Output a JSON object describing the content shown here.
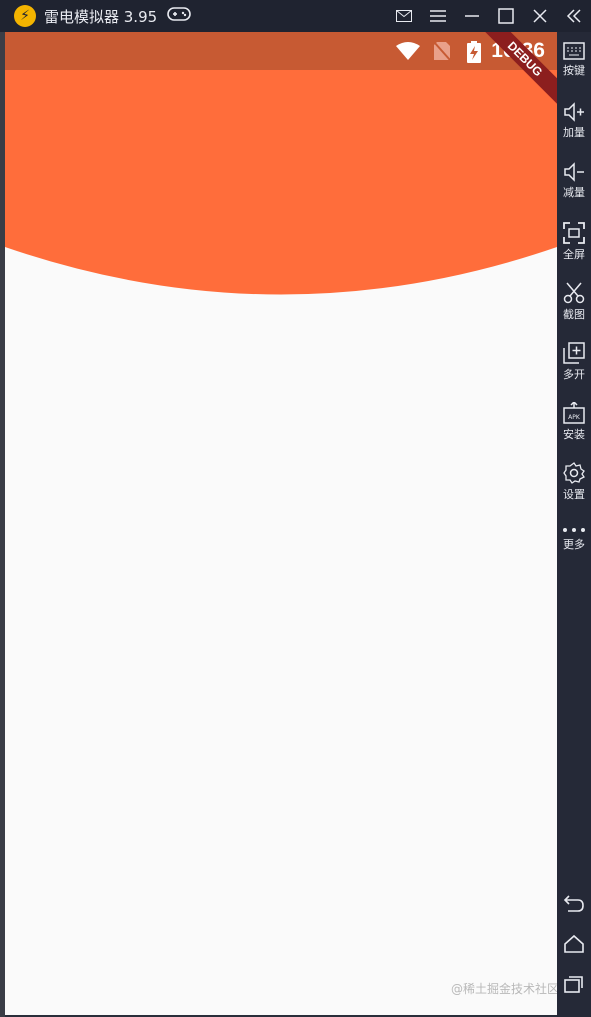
{
  "window": {
    "title": "雷电模拟器 3.95",
    "logo_icon": "leidian-logo",
    "controls": [
      "mail-icon",
      "menu-icon",
      "minimize-icon",
      "maximize-icon",
      "close-icon"
    ]
  },
  "status_bar": {
    "time": "10:36",
    "icons": [
      "wifi-icon",
      "no-sim-icon",
      "battery-charging-icon"
    ],
    "color": "#c75a33"
  },
  "debug_banner": "DEBUG",
  "app": {
    "header_color": "#ff6d3b",
    "background_color": "#fafafa"
  },
  "sidebar": {
    "items": [
      {
        "label": "按键",
        "icon": "keyboard-icon"
      },
      {
        "label": "加量",
        "icon": "volume-up-icon"
      },
      {
        "label": "减量",
        "icon": "volume-down-icon"
      },
      {
        "label": "全屏",
        "icon": "fullscreen-icon"
      },
      {
        "label": "截图",
        "icon": "scissors-icon"
      },
      {
        "label": "多开",
        "icon": "multi-instance-icon"
      },
      {
        "label": "安装",
        "icon": "apk-install-icon"
      },
      {
        "label": "设置",
        "icon": "gear-icon"
      },
      {
        "label": "更多",
        "icon": "more-icon"
      }
    ],
    "nav": [
      "back-icon",
      "home-icon",
      "recents-icon"
    ]
  },
  "watermark": "@稀土掘金技术社区"
}
